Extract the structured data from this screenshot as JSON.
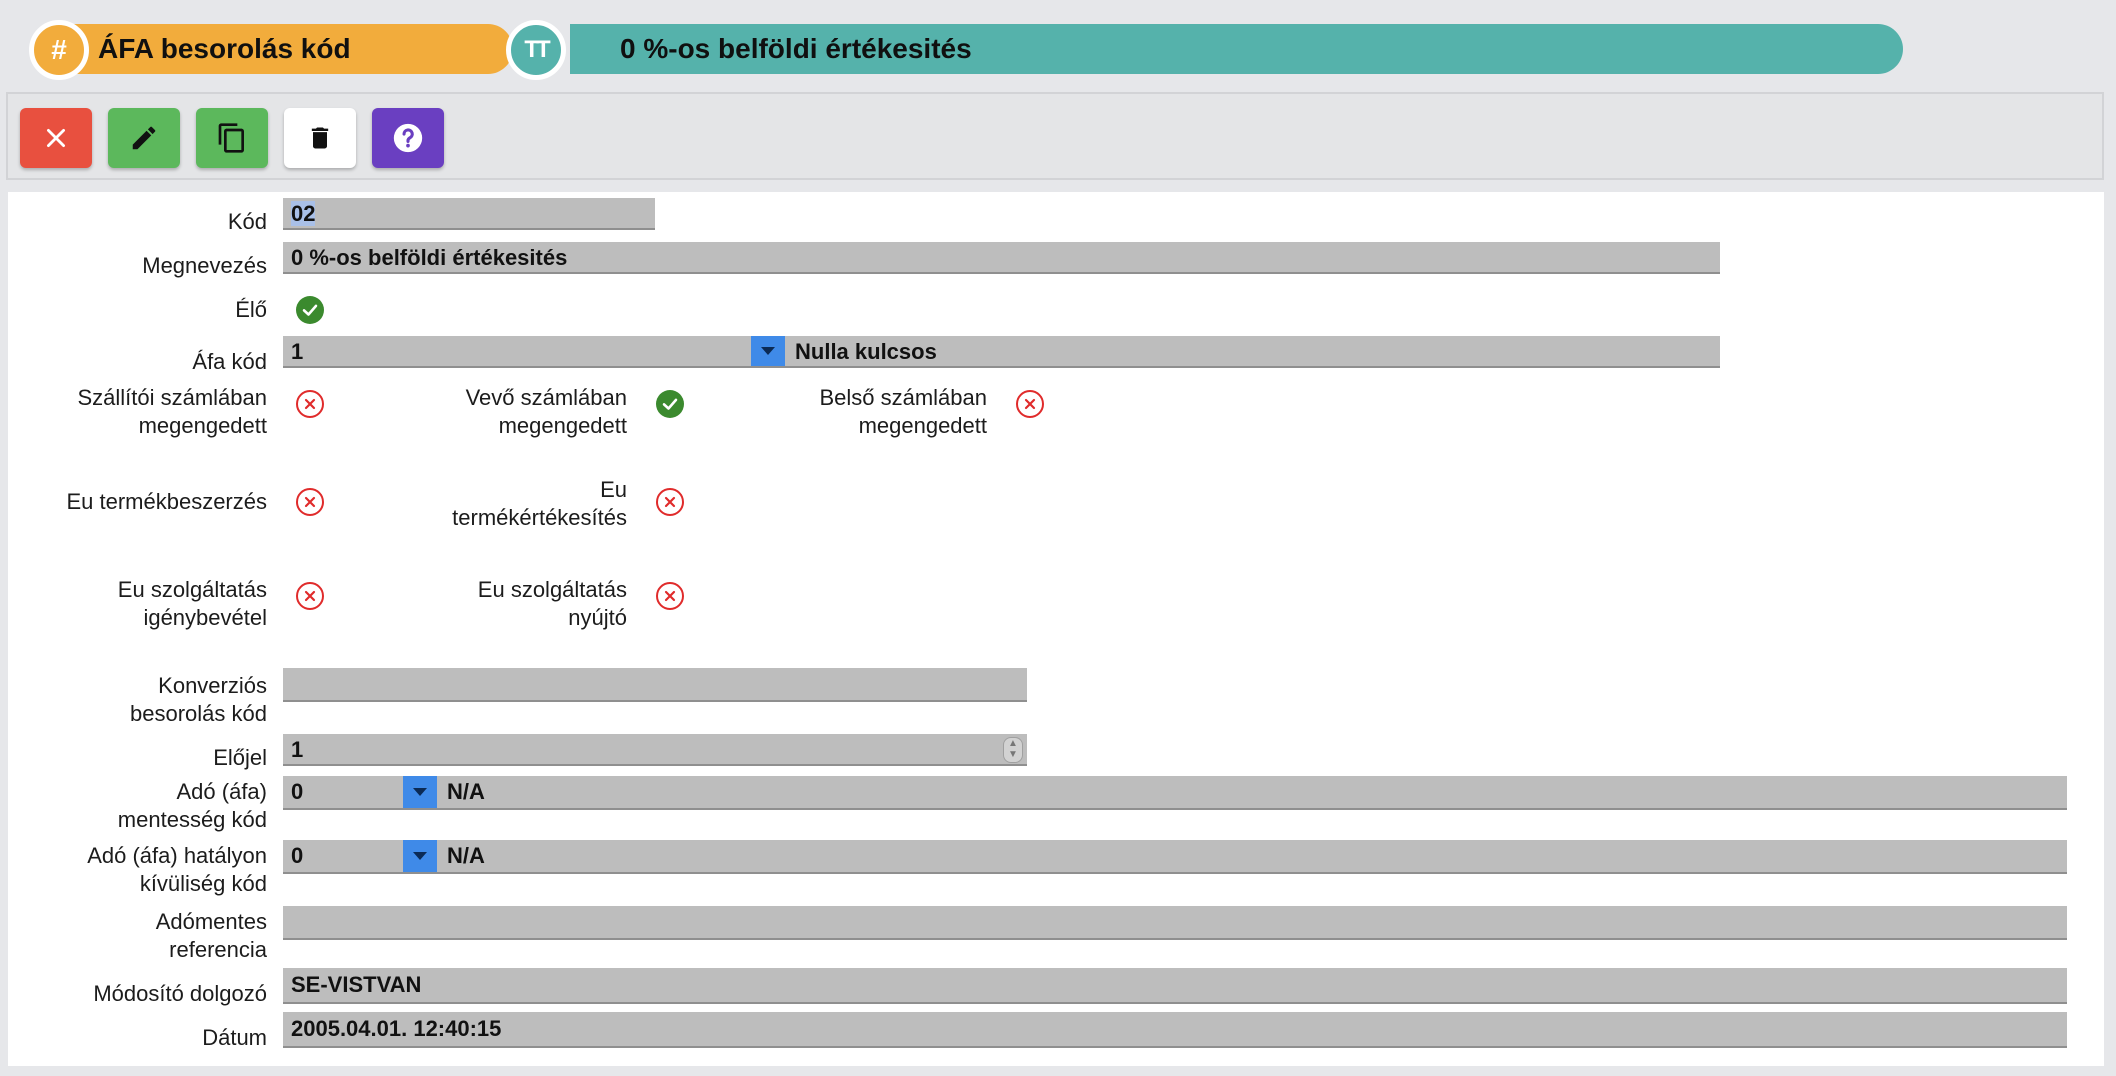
{
  "header": {
    "code_label": "ÁFA besorolás kód",
    "name_value": "0 %-os belföldi értékesités",
    "code_icon_glyph": "#",
    "name_icon_glyph": "TT"
  },
  "toolbar": {
    "buttons": [
      {
        "name": "close",
        "icon": "close-icon",
        "color": "#e8503f"
      },
      {
        "name": "edit",
        "icon": "pencil-icon",
        "color": "#5cb85c"
      },
      {
        "name": "copy",
        "icon": "copy-icon",
        "color": "#5cb85c"
      },
      {
        "name": "delete",
        "icon": "trash-icon",
        "color": "#ffffff"
      },
      {
        "name": "help",
        "icon": "help-icon",
        "color": "#6a3fc1"
      }
    ]
  },
  "form": {
    "kod": {
      "label": "Kód",
      "value": "02"
    },
    "megnevezes": {
      "label": "Megnevezés",
      "value": "0 %-os belföldi értékesités"
    },
    "elo": {
      "label": "Élő",
      "checked": true
    },
    "afa_kod": {
      "label": "Áfa kód",
      "value": "1",
      "description": "Nulla kulcsos"
    },
    "szallitoi": {
      "label_1": "Szállítói számlában",
      "label_2": "megengedett",
      "checked": false
    },
    "vevo": {
      "label_1": "Vevő számlában",
      "label_2": "megengedett",
      "checked": true
    },
    "belso": {
      "label_1": "Belső számlában",
      "label_2": "megengedett",
      "checked": false
    },
    "eu_termekbeszerzes": {
      "label": "Eu termékbeszerzés",
      "checked": false
    },
    "eu_termekertekesites": {
      "label_1": "Eu",
      "label_2": "termékértékesítés",
      "checked": false
    },
    "eu_szolg_igeny": {
      "label_1": "Eu szolgáltatás",
      "label_2": "igénybevétel",
      "checked": false
    },
    "eu_szolg_nyujto": {
      "label_1": "Eu szolgáltatás",
      "label_2": "nyújtó",
      "checked": false
    },
    "konverzios": {
      "label_1": "Konverziós",
      "label_2": "besorolás kód",
      "value": ""
    },
    "elojel": {
      "label": "Előjel",
      "value": "1"
    },
    "mentesseg": {
      "label_1": "Adó (áfa)",
      "label_2": "mentesség kód",
      "value": "0",
      "description": "N/A"
    },
    "hatalyon_kivul": {
      "label_1": "Adó (áfa) hatályon",
      "label_2": "kívüliség kód",
      "value": "0",
      "description": "N/A"
    },
    "adomentes_ref": {
      "label_1": "Adómentes",
      "label_2": "referencia",
      "value": ""
    },
    "modosito": {
      "label": "Módosító dolgozó",
      "value": "SE-VISTVAN"
    },
    "datum": {
      "label": "Dátum",
      "value": "2005.04.01. 12:40:15"
    }
  }
}
